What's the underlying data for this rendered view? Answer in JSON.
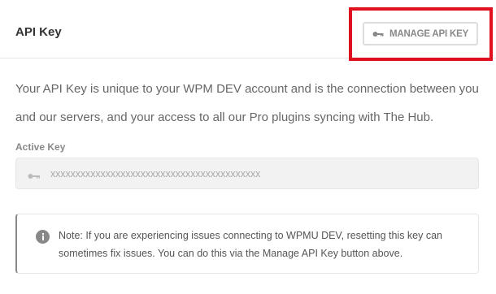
{
  "header": {
    "title": "API Key",
    "manage_button_label": "MANAGE API KEY",
    "manage_button_icon": "key-icon"
  },
  "description": "Your API Key is unique to your WPM DEV account and is the connection between you and our servers, and your access to all our Pro plugins syncing with The Hub.",
  "active_key": {
    "label": "Active Key",
    "icon": "key-icon",
    "value": "xxxxxxxxxxxxxxxxxxxxxxxxxxxxxxxxxxxxxxxxxx"
  },
  "notice": {
    "icon": "info-icon",
    "text": "Note: If you are experiencing issues connecting to WPMU DEV, resetting this key can sometimes fix issues. You can do this via the Manage API Key button above."
  },
  "colors": {
    "highlight": "#e0101e",
    "muted_text": "#888888",
    "field_bg": "#f2f2f2"
  }
}
